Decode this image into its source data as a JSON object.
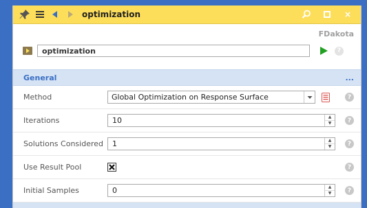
{
  "window": {
    "title": "optimization",
    "pin_icon": "pin-icon",
    "menu_icon": "hamburger-icon",
    "back_icon": "back-arrow-icon",
    "forward_icon": "forward-arrow-icon",
    "search_icon": "search-icon",
    "maximize_icon": "maximize-icon",
    "close_label": "×"
  },
  "header": {
    "product": "FDakota"
  },
  "node": {
    "name_value": "optimization",
    "run_icon": "play-icon",
    "help_label": "?"
  },
  "section": {
    "title": "General",
    "more_label": "..."
  },
  "fields": {
    "method": {
      "label": "Method",
      "value": "Global Optimization on Response Surface"
    },
    "iterations": {
      "label": "Iterations",
      "value": "10"
    },
    "solutions": {
      "label": "Solutions Considered",
      "value": "1"
    },
    "result_pool": {
      "label": "Use Result Pool",
      "checked": true
    },
    "initial_samples": {
      "label": "Initial Samples",
      "value": "0"
    }
  },
  "help_label": "?",
  "colors": {
    "background": "#3a6fc4",
    "titlebar": "#fdde5a",
    "section_bg": "#d6e3f5",
    "accent": "#3a6fc4",
    "run_green": "#22a022"
  }
}
